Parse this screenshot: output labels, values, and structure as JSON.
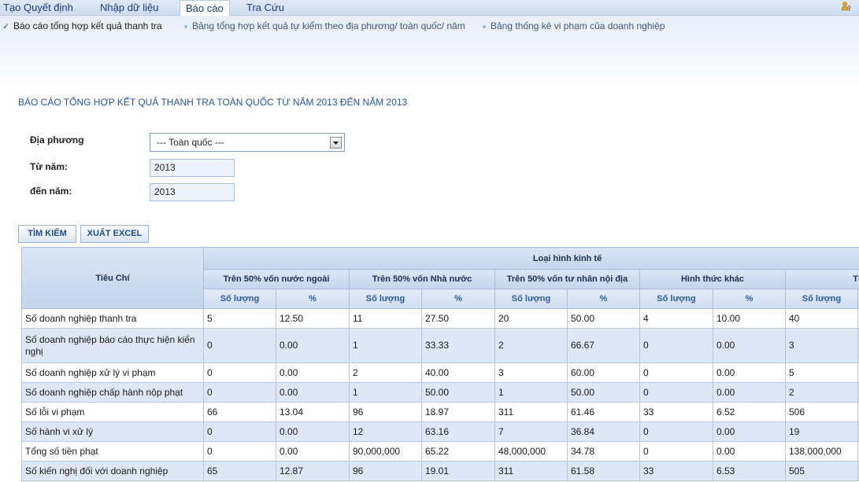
{
  "nav": {
    "tabs": [
      {
        "label": "Tạo Quyết định",
        "active": false
      },
      {
        "label": "Nhập dữ liệu",
        "active": false
      },
      {
        "label": "Báo cáo",
        "active": true
      },
      {
        "label": "Tra Cứu",
        "active": false
      }
    ],
    "user_icon": "user-key-icon"
  },
  "subnav": {
    "items": [
      {
        "label": "Báo cáo tổng hợp kết quả thanh tra",
        "icon": "check-icon",
        "active": true
      },
      {
        "label": "Bảng tổng hợp kết quả tự kiểm theo địa phương/ toàn quốc/ năm",
        "icon": "bullet-icon",
        "active": false
      },
      {
        "label": "Bảng thống kê vi phạm của doanh nghiệp",
        "icon": "bullet-icon",
        "active": false
      }
    ]
  },
  "page_title": "BÁO CÁO TỔNG HỢP KẾT QUẢ THANH TRA TOÀN QUỐC TỪ NĂM 2013 ĐẾN NĂM 2013",
  "form": {
    "region": {
      "label": "Địa phương",
      "value": "--- Toàn quốc ---",
      "icon": "chevron-down-icon"
    },
    "from_year": {
      "label": "Từ năm:",
      "value": "2013"
    },
    "to_year": {
      "label": "đến năm:",
      "value": "2013"
    }
  },
  "buttons": {
    "search": "TÌM KIẾM",
    "export": "XUẤT EXCEL"
  },
  "table": {
    "criteria_header": "Tiêu Chí",
    "group_header": "Loại hình kinh tế",
    "groups": [
      "Trên 50% vốn nước ngoài",
      "Trên 50% vốn Nhà nước",
      "Trên 50% vốn tư nhân nội địa",
      "Hình thức khác",
      "Tổ"
    ],
    "sub_headers": {
      "count": "Số lượng",
      "percent": "%"
    },
    "rows": [
      {
        "label": "Số doanh nghiệp thanh tra",
        "cells": [
          "5",
          "12.50",
          "11",
          "27.50",
          "20",
          "50.00",
          "4",
          "10.00",
          "40"
        ]
      },
      {
        "label": "Số doanh nghiệp báo cáo thực hiện kiến nghị",
        "cells": [
          "0",
          "0.00",
          "1",
          "33.33",
          "2",
          "66.67",
          "0",
          "0.00",
          "3"
        ]
      },
      {
        "label": "Số doanh nghiệp xử lý vi phạm",
        "cells": [
          "0",
          "0.00",
          "2",
          "40.00",
          "3",
          "60.00",
          "0",
          "0.00",
          "5"
        ]
      },
      {
        "label": "Số doanh nghiệp chấp hành nộp phạt",
        "cells": [
          "0",
          "0.00",
          "1",
          "50.00",
          "1",
          "50.00",
          "0",
          "0.00",
          "2"
        ]
      },
      {
        "label": "Số lỗi vi phạm",
        "cells": [
          "66",
          "13.04",
          "96",
          "18.97",
          "311",
          "61.46",
          "33",
          "6.52",
          "506"
        ]
      },
      {
        "label": "Số hành vi xử lý",
        "cells": [
          "0",
          "0.00",
          "12",
          "63.16",
          "7",
          "36.84",
          "0",
          "0.00",
          "19"
        ]
      },
      {
        "label": "Tổng số tiền phạt",
        "cells": [
          "0",
          "0.00",
          "90,000,000",
          "65.22",
          "48,000,000",
          "34.78",
          "0",
          "0.00",
          "138,000,000"
        ]
      },
      {
        "label": "Số kiến nghị đối với doanh nghiệp",
        "cells": [
          "65",
          "12.87",
          "96",
          "19.01",
          "311",
          "61.58",
          "33",
          "6.53",
          "505"
        ]
      }
    ]
  },
  "colors": {
    "nav_bg": "#cedcef",
    "accent": "#2456a4",
    "header_bg": "#c3d4ec",
    "row_alt_bg": "#dde7f5",
    "button_text": "#1e4a8e"
  }
}
